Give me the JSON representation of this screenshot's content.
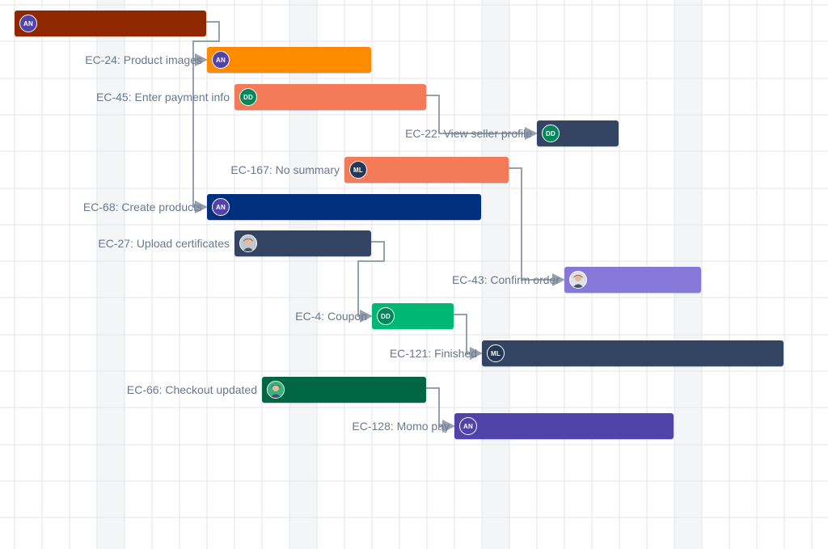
{
  "colors": {
    "grid_line": "#e4e6ea",
    "weekend_band": "#f4f5f7",
    "arrow": "#97a0af",
    "label_text": "#6b778c"
  },
  "avatars": {
    "AN": {
      "initials": "AN",
      "color": "#5243aa"
    },
    "DD": {
      "initials": "DD",
      "color": "#00875a"
    },
    "ML": {
      "initials": "ML",
      "color": "#253858"
    },
    "photo_1": {
      "initials": "",
      "color": "#c1c7d0",
      "icon": "person-photo-icon"
    },
    "photo_2": {
      "initials": "",
      "color": "#dfe1e6",
      "icon": "person-photo-icon"
    },
    "photo_3": {
      "initials": "",
      "color": "#36b37e",
      "icon": "person-photo-icon"
    }
  },
  "issues": [
    {
      "key": "top",
      "label": "",
      "color": "#8f2700",
      "avatar": "AN"
    },
    {
      "key": "EC-24",
      "label": "EC-24: Product images",
      "color": "#ff8b00",
      "avatar": "AN"
    },
    {
      "key": "EC-45",
      "label": "EC-45: Enter payment info",
      "color": "#f57a58",
      "avatar": "DD"
    },
    {
      "key": "EC-22",
      "label": "EC-22: View seller profile",
      "color": "#344563",
      "avatar": "DD"
    },
    {
      "key": "EC-167",
      "label": "EC-167: No summary",
      "color": "#f57a58",
      "avatar": "ML"
    },
    {
      "key": "EC-68",
      "label": "EC-68: Create products",
      "color": "#00307d",
      "avatar": "AN"
    },
    {
      "key": "EC-27",
      "label": "EC-27: Upload certificates",
      "color": "#344563",
      "avatar": "photo_1"
    },
    {
      "key": "EC-43",
      "label": "EC-43: Confirm order",
      "color": "#8777d9",
      "avatar": "photo_2"
    },
    {
      "key": "EC-4",
      "label": "EC-4: Coupon",
      "color": "#00b874",
      "avatar": "DD"
    },
    {
      "key": "EC-121",
      "label": "EC-121: Finished",
      "color": "#344563",
      "avatar": "ML"
    },
    {
      "key": "EC-66",
      "label": "EC-66: Checkout updated",
      "color": "#006644",
      "avatar": "photo_3"
    },
    {
      "key": "EC-128",
      "label": "EC-128: Momo pay",
      "color": "#5243aa",
      "avatar": "AN"
    }
  ],
  "dependencies": [
    [
      "top",
      "EC-24"
    ],
    [
      "top",
      "EC-68"
    ],
    [
      "EC-45",
      "EC-22"
    ],
    [
      "EC-167",
      "EC-43"
    ],
    [
      "EC-27",
      "EC-4"
    ],
    [
      "EC-4",
      "EC-121"
    ],
    [
      "EC-66",
      "EC-128"
    ]
  ]
}
